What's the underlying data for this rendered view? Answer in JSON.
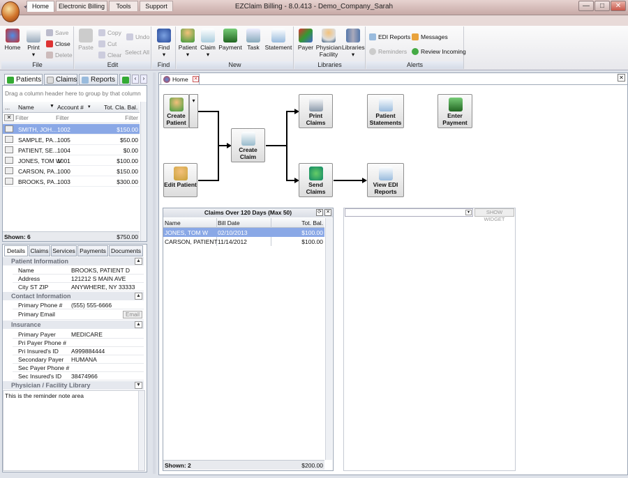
{
  "window": {
    "title": "EZClaim Billing - 8.0.413 - Demo_Company_Sarah",
    "min": "—",
    "max": "□",
    "close": "✕"
  },
  "ribbon_tabs": [
    "Home",
    "Electronic Billing",
    "Tools",
    "Support"
  ],
  "ribbon": {
    "file": {
      "label": "File",
      "home": "Home",
      "print": "Print",
      "save": "Save",
      "close": "Close",
      "delete": "Delete"
    },
    "edit": {
      "label": "Edit",
      "paste": "Paste",
      "copy": "Copy",
      "cut": "Cut",
      "clear": "Clear",
      "undo": "Undo",
      "select_all": "Select All"
    },
    "find": {
      "label": "Find",
      "find": "Find"
    },
    "new": {
      "label": "New",
      "patient": "Patient",
      "claim": "Claim",
      "payment": "Payment",
      "task": "Task",
      "statement": "Statement"
    },
    "libraries": {
      "label": "Libraries",
      "payer": "Payer",
      "physician": "Physician",
      "facility": "Facility",
      "libraries": "Libraries"
    },
    "alerts": {
      "label": "Alerts",
      "edi_reports": "EDI Reports",
      "reminders": "Reminders",
      "messages": "Messages",
      "review_incoming": "Review Incoming"
    }
  },
  "left_tabs": [
    "Patients",
    "Claims",
    "Reports"
  ],
  "patients": {
    "group_hint": "Drag a column header here to group by that column",
    "columns": {
      "more": "...",
      "name": "Name",
      "account": "Account #",
      "balance": "Tot. Cla. Bal."
    },
    "filter_placeholder": "Filter",
    "rows": [
      {
        "name": "SMITH, JOH...",
        "account": "1002",
        "balance": "$150.00"
      },
      {
        "name": "SAMPLE, PA...",
        "account": "1005",
        "balance": "$50.00"
      },
      {
        "name": "PATIENT, SE...",
        "account": "1004",
        "balance": "$0.00"
      },
      {
        "name": "JONES, TOM W",
        "account": "1001",
        "balance": "$100.00"
      },
      {
        "name": "CARSON, PA...",
        "account": "1000",
        "balance": "$150.00"
      },
      {
        "name": "BROOKS, PA...",
        "account": "1003",
        "balance": "$300.00"
      }
    ],
    "shown": "Shown: 6",
    "total": "$750.00"
  },
  "detail_tabs": [
    "Details",
    "Claims",
    "Services",
    "Payments",
    "Documents"
  ],
  "details": {
    "patient_info": {
      "title": "Patient Information",
      "name_k": "Name",
      "name_v": "BROOKS, PATIENT D",
      "address_k": "Address",
      "address_v": "121212 S MAIN AVE",
      "city_k": "City ST ZIP",
      "city_v": "ANYWHERE, NY 33333"
    },
    "contact": {
      "title": "Contact Information",
      "phone_k": "Primary Phone #",
      "phone_v": "(555) 555-6666",
      "email_k": "Primary Email",
      "email_btn": "Email"
    },
    "insurance": {
      "title": "Insurance",
      "pp_k": "Primary Payer",
      "pp_v": "MEDICARE",
      "ppp_k": "Pri Payer Phone #",
      "ppp_v": "",
      "pid_k": "Pri Insured's ID",
      "pid_v": "A999884444",
      "sp_k": "Secondary Payer",
      "sp_v": "HUMANA",
      "spp_k": "Sec Payer Phone #",
      "spp_v": "",
      "sid_k": "Sec Insured's ID",
      "sid_v": "38474966"
    },
    "physician": {
      "title": "Physician / Facility Library"
    },
    "reminder": "This is the reminder note area"
  },
  "home_tab": {
    "label": "Home"
  },
  "workflow": {
    "create_patient": "Create Patient",
    "edit_patient": "Edit Patient",
    "create_claim": "Create Claim",
    "print_claims": "Print Claims",
    "send_claims": "Send Claims",
    "patient_statements": "Patient Statements",
    "view_edi": "View EDI Reports",
    "enter_payment": "Enter Payment"
  },
  "claims_widget": {
    "title": "Claims Over 120 Days (Max 50)",
    "columns": {
      "name": "Name",
      "date": "Bill Date",
      "bal": "Tot. Bal."
    },
    "rows": [
      {
        "name": "JONES, TOM W",
        "date": "02/10/2013",
        "bal": "$100.00"
      },
      {
        "name": "CARSON, PATIENT",
        "date": "11/14/2012",
        "bal": "$100.00"
      }
    ],
    "shown": "Shown: 2",
    "total": "$200.00"
  },
  "widget_picker": {
    "show_button": "SHOW WIDGET"
  }
}
